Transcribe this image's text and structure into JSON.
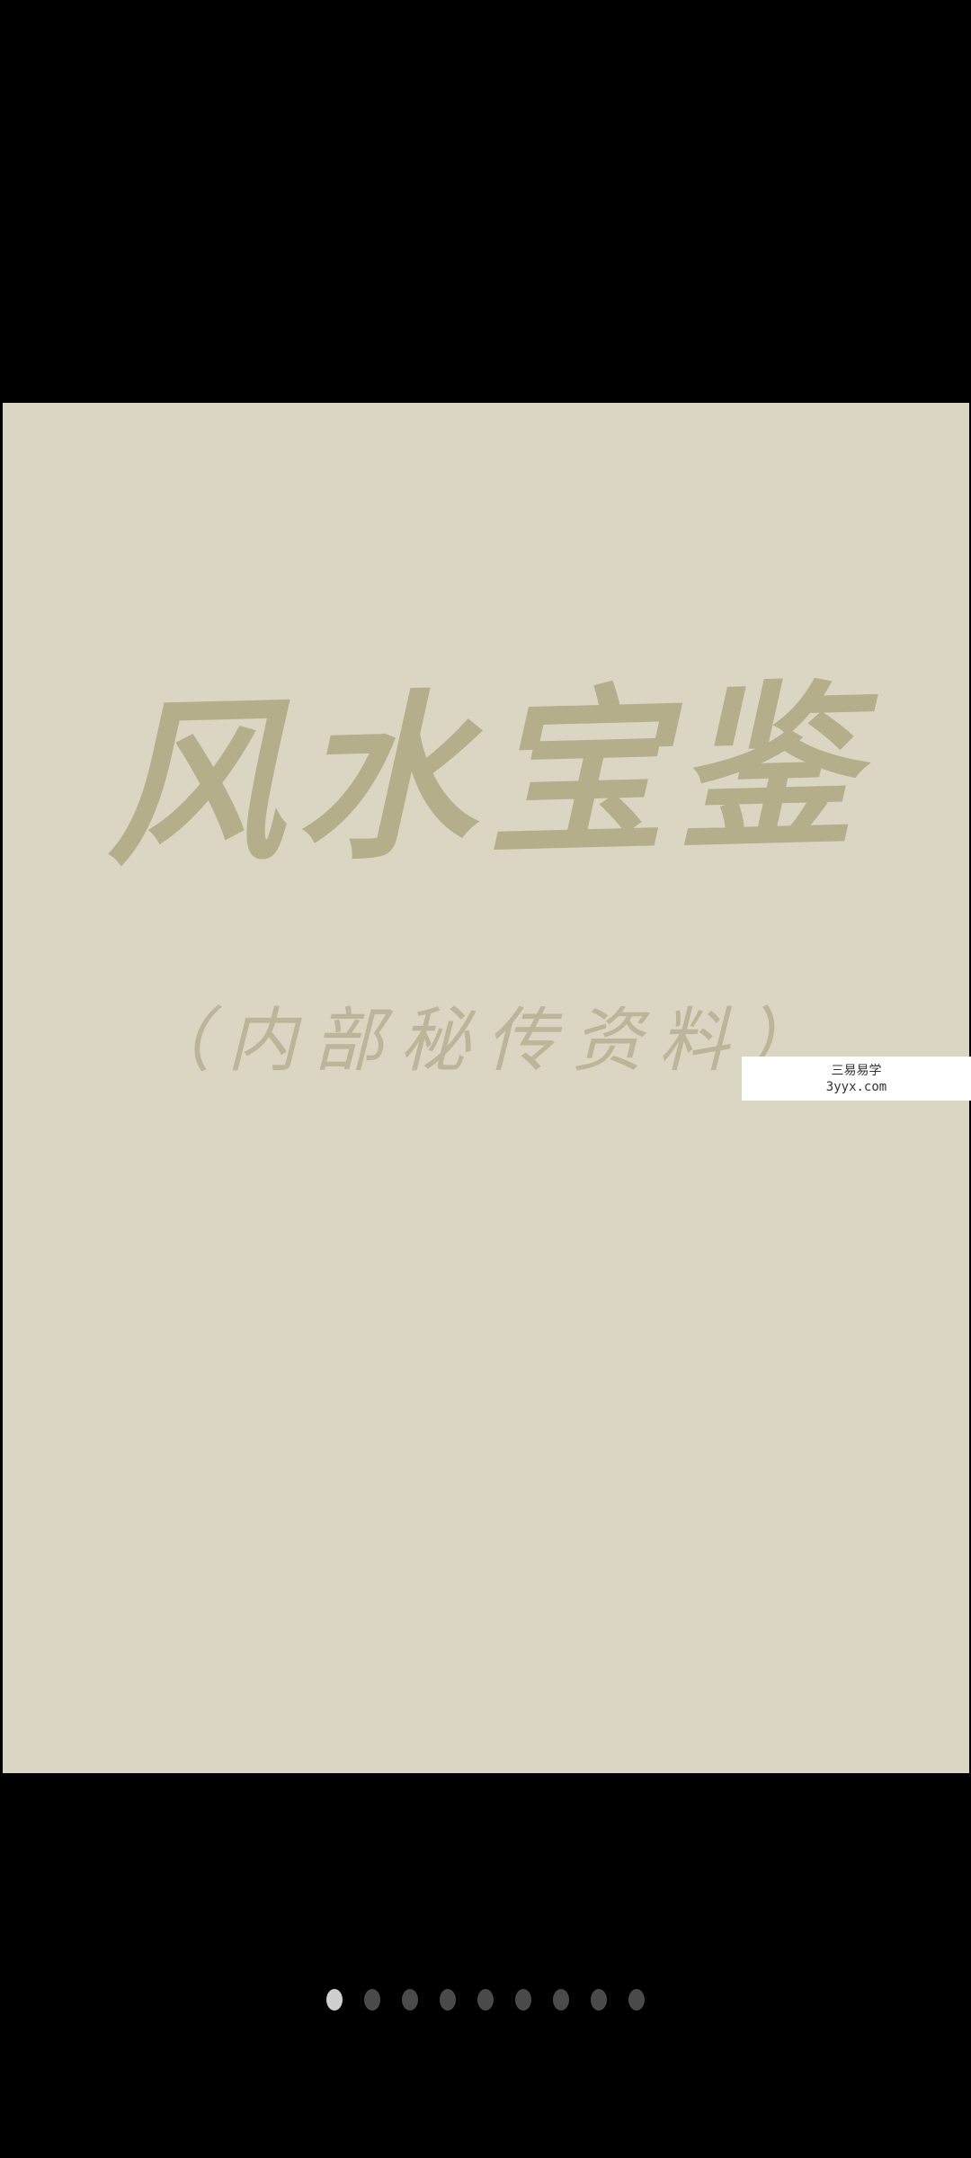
{
  "image": {
    "title": "风水宝鉴",
    "subtitle": "（内部秘传资料）"
  },
  "watermark": {
    "line1": "三易易学",
    "line2": "3yyx.com"
  },
  "pager": {
    "total": 9,
    "current": 1
  },
  "colors": {
    "background": "#000000",
    "page": "#dbd6c3",
    "ink": "#b3ac86",
    "dot_active": "#cfcfcf",
    "dot_inactive": "#4a4a4a"
  }
}
